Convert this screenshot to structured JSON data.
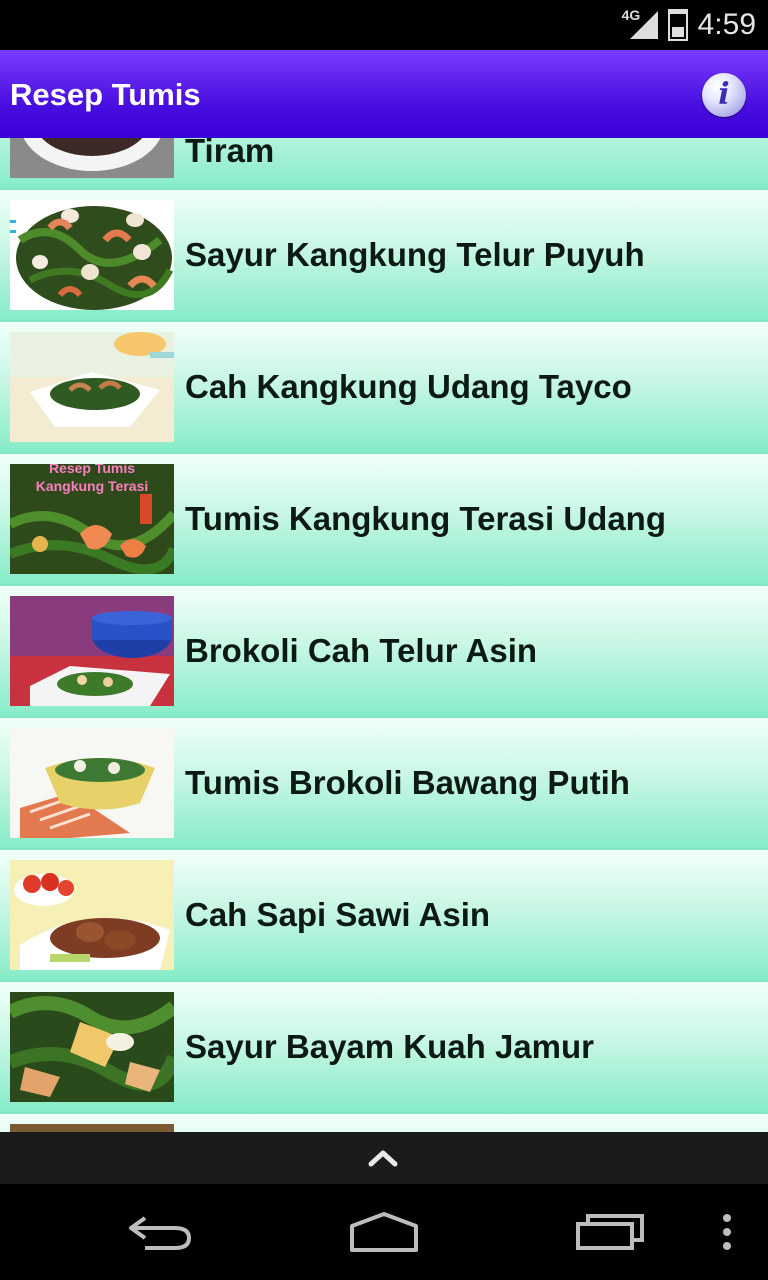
{
  "status": {
    "network": "4G",
    "time": "4:59"
  },
  "app": {
    "title": "Resep Tumis"
  },
  "items": [
    {
      "title": "Tiram",
      "thumb": "tiram-dish-image"
    },
    {
      "title": "Sayur Kangkung Telur Puyuh",
      "thumb": "kangkung-quail-egg-image"
    },
    {
      "title": "Cah Kangkung Udang Tayco",
      "thumb": "kangkung-shrimp-image"
    },
    {
      "title": "Tumis Kangkung Terasi Udang",
      "thumb": "kangkung-terasi-image",
      "thumb_caption": "Resep Tumis\nKangkung Terasi"
    },
    {
      "title": "Brokoli Cah Telur Asin",
      "thumb": "broccoli-salted-egg-image"
    },
    {
      "title": "Tumis Brokoli Bawang Putih",
      "thumb": "broccoli-garlic-image"
    },
    {
      "title": "Cah Sapi Sawi Asin",
      "thumb": "beef-mustard-greens-image"
    },
    {
      "title": "Sayur Bayam Kuah Jamur",
      "thumb": "spinach-mushroom-image"
    },
    {
      "title": "",
      "thumb": "next-dish-image"
    }
  ],
  "icons": {
    "info": "info-icon",
    "scroll_up": "chevron-up-icon",
    "back": "back-icon",
    "home": "home-icon",
    "recents": "recent-apps-icon",
    "menu": "overflow-menu-icon"
  }
}
